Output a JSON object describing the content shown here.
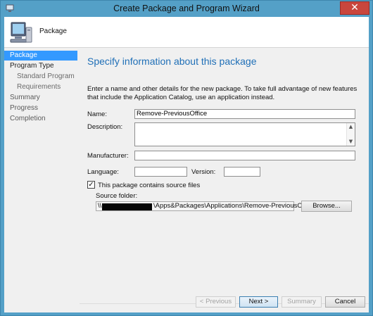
{
  "window": {
    "title": "Create Package and Program Wizard",
    "close_glyph": "✕"
  },
  "header": {
    "title": "Package",
    "icon": "computer-icon"
  },
  "nav": {
    "items": [
      {
        "label": "Package",
        "state": "selected"
      },
      {
        "label": "Program Type",
        "state": "strong"
      },
      {
        "label": "Standard Program",
        "state": "sub"
      },
      {
        "label": "Requirements",
        "state": "sub"
      },
      {
        "label": "Summary",
        "state": "normal"
      },
      {
        "label": "Progress",
        "state": "normal"
      },
      {
        "label": "Completion",
        "state": "normal"
      }
    ]
  },
  "main": {
    "heading": "Specify information about this package",
    "intro": "Enter a name and other details for the new package. To take full advantage of new features that include the Application Catalog, use an application instead.",
    "name_label": "Name:",
    "name_value": "Remove-PreviousOffice",
    "description_label": "Description:",
    "description_value": "",
    "manufacturer_label": "Manufacturer:",
    "manufacturer_value": "",
    "language_label": "Language:",
    "language_value": "",
    "version_label": "Version:",
    "version_value": "",
    "source_checkbox_label": "This package contains source files",
    "source_checked": true,
    "source_folder_label": "Source folder:",
    "source_folder_prefix": "\\\\",
    "source_folder_suffix": "\\Apps&Packages\\Applications\\Remove-PreviousOfficeInstalls",
    "browse_label": "Browse..."
  },
  "footer": {
    "previous_label": "< Previous",
    "next_label": "Next >",
    "summary_label": "Summary",
    "cancel_label": "Cancel"
  },
  "colors": {
    "accent": "#1f6fb7",
    "selection": "#3399ff",
    "frame": "#54a0c7"
  }
}
